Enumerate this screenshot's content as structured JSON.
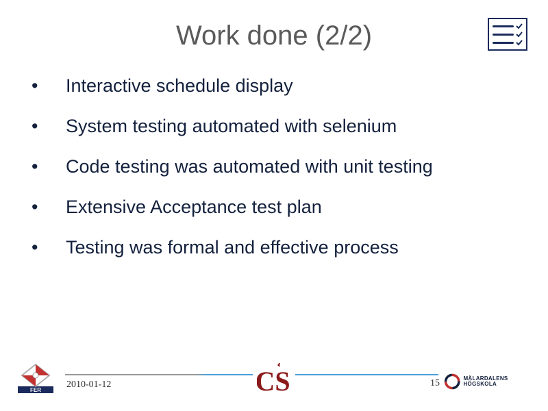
{
  "title": "Work done (2/2)",
  "bullets": [
    "Interactive schedule display",
    "System testing automated with selenium",
    "Code testing was automated with unit testing",
    "Extensive Acceptance test plan",
    "Testing was formal and effective process"
  ],
  "footer": {
    "date": "2010-01-12",
    "page": "15",
    "right_logo_text": "MÄLARDALENS HÖGSKOLA"
  }
}
